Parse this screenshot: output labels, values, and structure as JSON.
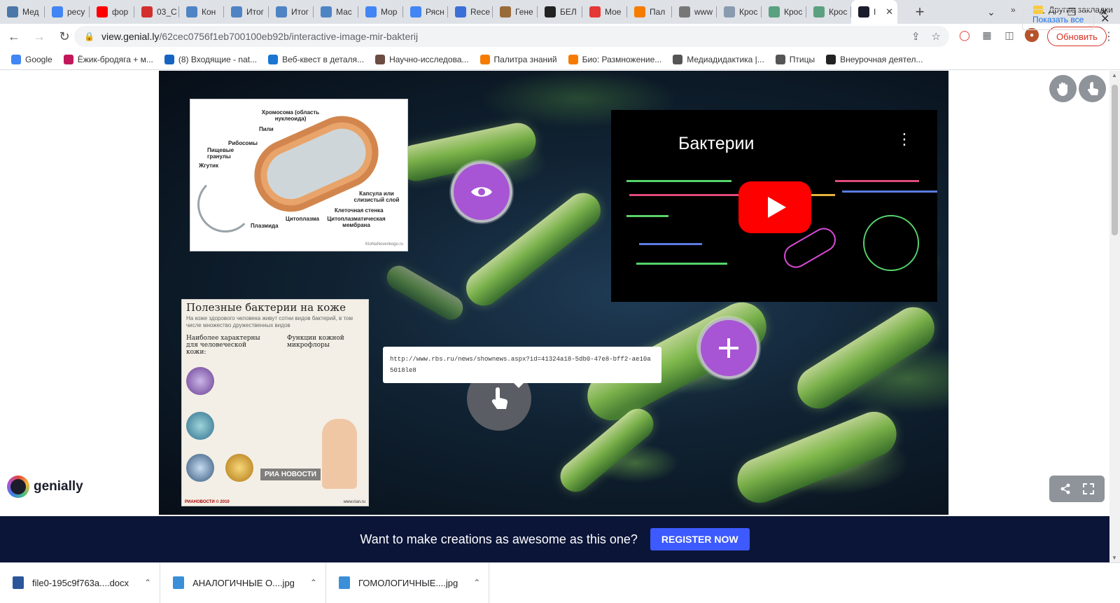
{
  "browser": {
    "tabs": [
      {
        "label": "Мед",
        "icon": "vk-icon",
        "color": "#4a76a8"
      },
      {
        "label": "ресу",
        "icon": "google-icon",
        "color": "#4285f4"
      },
      {
        "label": "фор",
        "icon": "youtube-icon",
        "color": "#ff0000"
      },
      {
        "label": "03_С",
        "icon": "pdf-icon",
        "color": "#d32f2f"
      },
      {
        "label": "Кон",
        "icon": "doc-icon",
        "color": "#4f84c4"
      },
      {
        "label": "Итог",
        "icon": "doc-icon",
        "color": "#4f84c4"
      },
      {
        "label": "Итог",
        "icon": "doc-icon",
        "color": "#4f84c4"
      },
      {
        "label": "Мас",
        "icon": "doc-icon",
        "color": "#4f84c4"
      },
      {
        "label": "Мор",
        "icon": "google-icon",
        "color": "#4285f4"
      },
      {
        "label": "Рясн",
        "icon": "google-icon",
        "color": "#4285f4"
      },
      {
        "label": "Rece",
        "icon": "c-icon",
        "color": "#3b6fd8"
      },
      {
        "label": "Гене",
        "icon": "image-icon",
        "color": "#9a6b3a"
      },
      {
        "label": "БЕЛ",
        "icon": "avatar-icon",
        "color": "#222222"
      },
      {
        "label": "Мое",
        "icon": "w-icon",
        "color": "#e53935"
      },
      {
        "label": "Пал",
        "icon": "blogger-icon",
        "color": "#f57c00"
      },
      {
        "label": "www",
        "icon": "globe-icon",
        "color": "#777777"
      },
      {
        "label": "Крос",
        "icon": "image-icon",
        "color": "#8a9bb0"
      },
      {
        "label": "Крос",
        "icon": "image-icon",
        "color": "#5aa17f"
      },
      {
        "label": "Крос",
        "icon": "image-icon",
        "color": "#5aa17f"
      },
      {
        "label": "I",
        "icon": "genially-icon",
        "color": "#1b1d2b",
        "active": true
      }
    ],
    "url_host": "view.genial.ly",
    "url_path": "/62cec0756f1eb700100eb92b/interactive-image-mir-bakterij",
    "update_label": "Обновить",
    "bookmarks": [
      {
        "label": "Google",
        "color": "#4285f4"
      },
      {
        "label": "Ёжик-бродяга + м...",
        "color": "#c2185b"
      },
      {
        "label": "(8) Входящие - nat...",
        "color": "#1565c0"
      },
      {
        "label": "Веб-квест в деталя...",
        "color": "#1976d2"
      },
      {
        "label": "Научно-исследова...",
        "color": "#6d4c41"
      },
      {
        "label": "Палитра знаний",
        "color": "#f57c00"
      },
      {
        "label": "Био: Размножение...",
        "color": "#f57c00"
      },
      {
        "label": "Медиадидактика |...",
        "color": "#555555"
      },
      {
        "label": "Птицы",
        "color": "#555555"
      },
      {
        "label": "Внеурочная деятел...",
        "color": "#222222"
      }
    ],
    "bookmarks_more": "»",
    "other_bookmarks": "Другие закладки"
  },
  "page": {
    "diagram": {
      "labels": {
        "chromosome": "Хромосома (область нуклеоида)",
        "pili": "Пили",
        "ribosomes": "Рибосомы",
        "granules": "Пищевые гранулы",
        "flagellum": "Жгутик",
        "capsule": "Капсула или слизистый слой",
        "cell_wall": "Клеточная стенка",
        "cytoplasm": "Цитоплазма",
        "membrane": "Цитоплазматическая мембрана",
        "plasmid": "Плазмида"
      },
      "watermark": "KtoNaNovenkogo.ru"
    },
    "poster": {
      "title": "Полезные бактерии на коже",
      "subtitle": "На коже здорового человека живут сотни видов бактерий, в том числе множество дружественных видов",
      "col1": "Наиболее характерны для человеческой кожи:",
      "col2": "Функции кожной микрофлоры",
      "ria": "РИА НОВОСТИ",
      "footer_left": "РИАНОВОСТИ © 2010",
      "footer_right": "www.rian.ru"
    },
    "video": {
      "title": "Бактерии"
    },
    "tooltip_url": "http://www.rbs.ru/news/shownews.aspx?id=41324a18-5db0-47e8-bff2-ae10a5018le8",
    "brand": "genially",
    "promo_text": "Want to make creations as awesome as this one?",
    "register_label": "REGISTER NOW"
  },
  "downloads": {
    "items": [
      {
        "name": "file0-195c9f763a....docx",
        "color": "#2b579a"
      },
      {
        "name": "АНАЛОГИЧНЫЕ О....jpg",
        "color": "#3a8fd8"
      },
      {
        "name": "ГОМОЛОГИЧНЫЕ....jpg",
        "color": "#3a8fd8"
      }
    ],
    "show_all": "Показать все"
  }
}
